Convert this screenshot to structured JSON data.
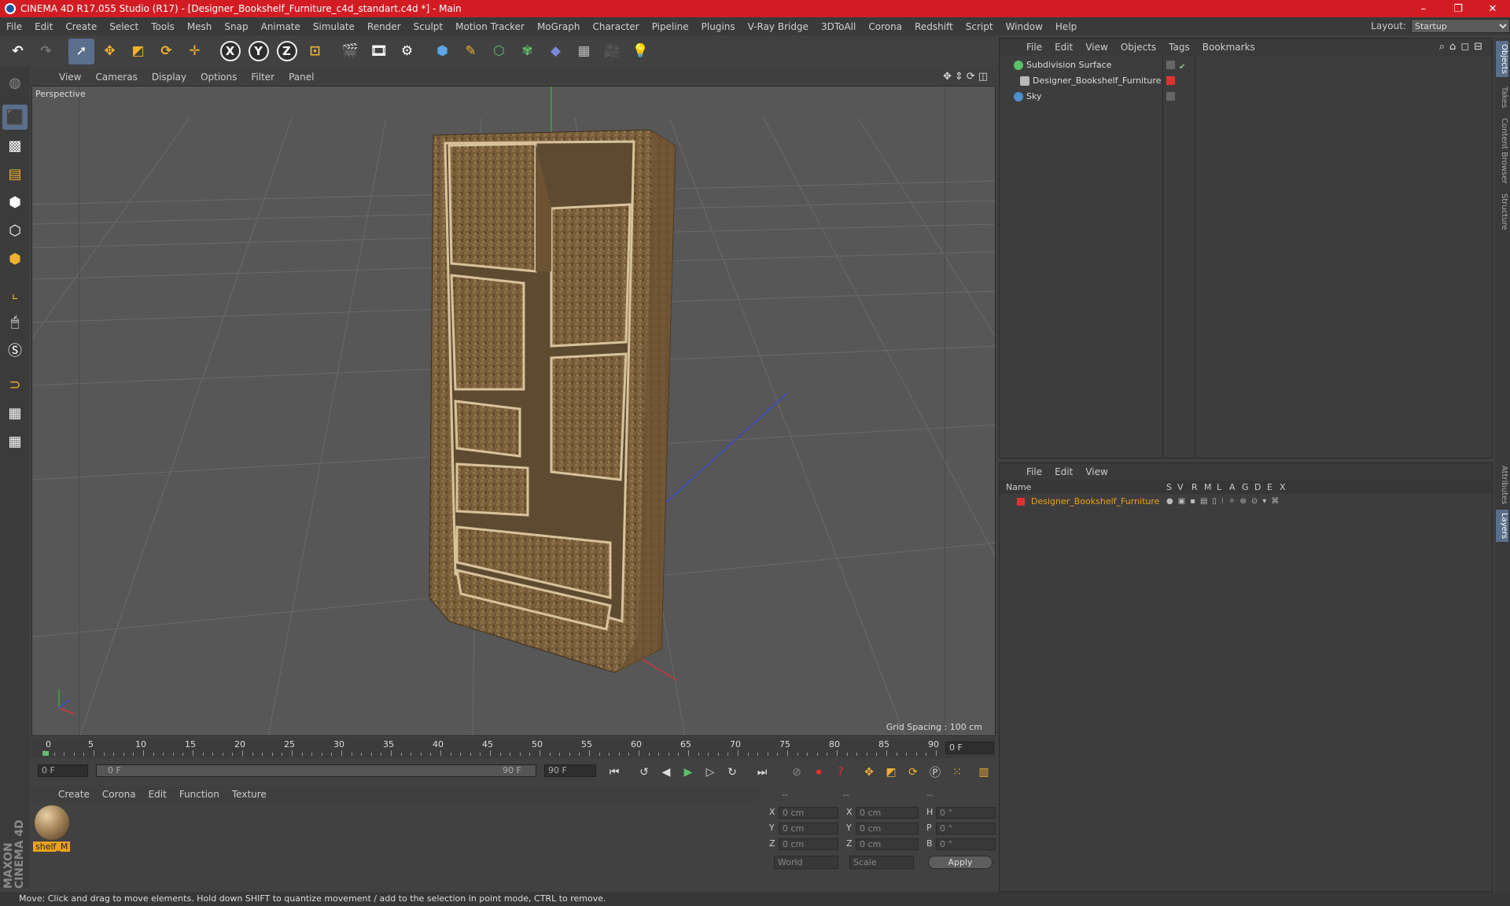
{
  "window": {
    "title": "CINEMA 4D R17.055 Studio (R17) - [Designer_Bookshelf_Furniture_c4d_standart.c4d *] - Main",
    "controls": [
      "–",
      "❐",
      "✕"
    ]
  },
  "menubar": {
    "items": [
      "File",
      "Edit",
      "Create",
      "Select",
      "Tools",
      "Mesh",
      "Snap",
      "Animate",
      "Simulate",
      "Render",
      "Sculpt",
      "Motion Tracker",
      "MoGraph",
      "Character",
      "Pipeline",
      "Plugins",
      "V-Ray Bridge",
      "3DToAll",
      "Corona",
      "Redshift",
      "Script",
      "Window",
      "Help"
    ],
    "layout_label": "Layout:",
    "layout_value": "Startup"
  },
  "toolbar": {
    "axis_labels": [
      "X",
      "Y",
      "Z"
    ]
  },
  "viewport": {
    "menu": [
      "View",
      "Cameras",
      "Display",
      "Options",
      "Filter",
      "Panel"
    ],
    "label": "Perspective",
    "grid_spacing": "Grid Spacing : 100 cm"
  },
  "timeline": {
    "ticks": [
      "0",
      "5",
      "10",
      "15",
      "20",
      "25",
      "30",
      "35",
      "40",
      "45",
      "50",
      "55",
      "60",
      "65",
      "70",
      "75",
      "80",
      "85",
      "90"
    ],
    "current_frame": "0 F"
  },
  "playbar": {
    "start": "0 F",
    "range_start": "0 F",
    "range_end": "90 F",
    "end": "90 F"
  },
  "materials": {
    "menu": [
      "Create",
      "Corona",
      "Edit",
      "Function",
      "Texture"
    ],
    "items": [
      {
        "name": "shelf_M"
      }
    ]
  },
  "coords": {
    "headers": [
      "--",
      "--",
      "--"
    ],
    "rows": [
      {
        "a": "X",
        "av": "0 cm",
        "b": "X",
        "bv": "0 cm",
        "c": "H",
        "cv": "0 °"
      },
      {
        "a": "Y",
        "av": "0 cm",
        "b": "Y",
        "bv": "0 cm",
        "c": "P",
        "cv": "0 °"
      },
      {
        "a": "Z",
        "av": "0 cm",
        "b": "Z",
        "bv": "0 cm",
        "c": "B",
        "cv": "0 °"
      }
    ],
    "mode1": "World",
    "mode2": "Scale",
    "apply": "Apply"
  },
  "objects": {
    "menu": [
      "File",
      "Edit",
      "View",
      "Objects",
      "Tags",
      "Bookmarks"
    ],
    "items": [
      {
        "name": "Subdivision Surface",
        "color": "#5ac06a"
      },
      {
        "name": "Designer_Bookshelf_Furniture",
        "color": "#b8b8b8"
      },
      {
        "name": "Sky",
        "color": "#4f8fd0"
      }
    ]
  },
  "layers": {
    "menu": [
      "File",
      "Edit",
      "View"
    ],
    "columns": [
      "Name",
      "S",
      "V",
      "R",
      "M",
      "L",
      "A",
      "G",
      "D",
      "E",
      "X"
    ],
    "rows": [
      {
        "name": "Designer_Bookshelf_Furniture",
        "color": "#e03030"
      }
    ]
  },
  "right_tabs": [
    "Objects",
    "Takes",
    "Content Browser",
    "Structure",
    "Attributes",
    "Layers"
  ],
  "status": "Move: Click and drag to move elements. Hold down SHIFT to quantize movement / add to the selection in point mode, CTRL to remove.",
  "branding": "MAXON CINEMA 4D",
  "colors": {
    "titlebar": "#d21c24",
    "accent": "#5a6f8c",
    "selection": "#e8a21c"
  }
}
